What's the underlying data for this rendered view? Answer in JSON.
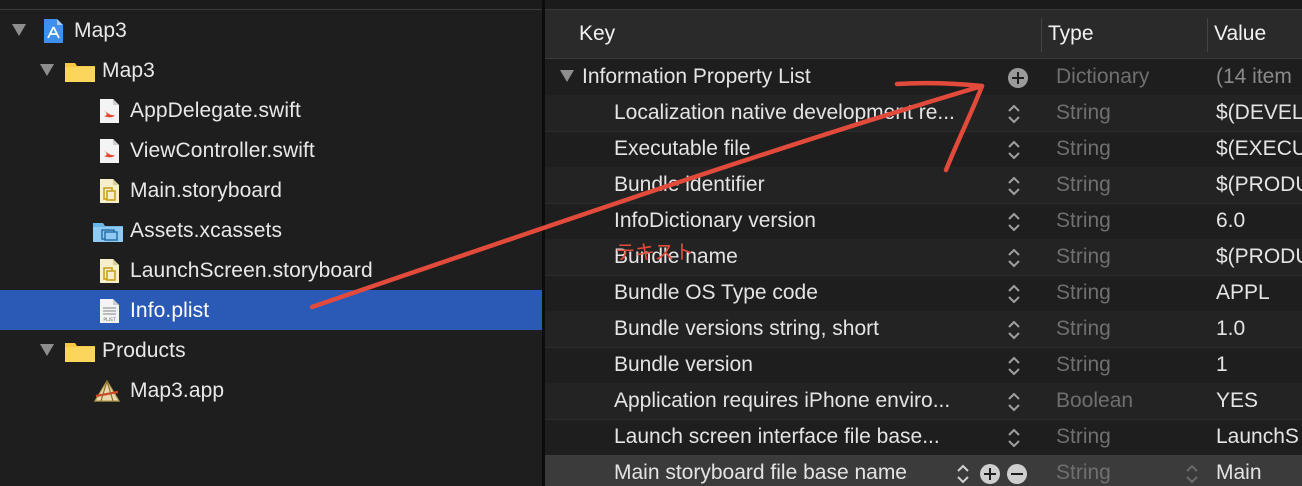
{
  "navigator": {
    "items": [
      {
        "label": "Map3",
        "icon": "xcode-project-icon",
        "expanded": true
      },
      {
        "label": "Map3",
        "icon": "folder-icon",
        "expanded": true
      },
      {
        "label": "AppDelegate.swift",
        "icon": "swift-file-icon"
      },
      {
        "label": "ViewController.swift",
        "icon": "swift-file-icon"
      },
      {
        "label": "Main.storyboard",
        "icon": "storyboard-file-icon"
      },
      {
        "label": "Assets.xcassets",
        "icon": "asset-catalog-icon"
      },
      {
        "label": "LaunchScreen.storyboard",
        "icon": "storyboard-file-icon"
      },
      {
        "label": "Info.plist",
        "icon": "plist-file-icon",
        "selected": true,
        "icon_text": "PLIST"
      },
      {
        "label": "Products",
        "icon": "folder-icon",
        "expanded": true
      },
      {
        "label": "Map3.app",
        "icon": "app-product-icon"
      }
    ]
  },
  "plist": {
    "headers": {
      "key": "Key",
      "type": "Type",
      "value": "Value"
    },
    "root": {
      "key": "Information Property List",
      "type": "Dictionary",
      "value": "(14 item"
    },
    "rows": [
      {
        "key": "Localization native development re...",
        "type": "String",
        "value": "$(DEVEL"
      },
      {
        "key": "Executable file",
        "type": "String",
        "value": "$(EXECU"
      },
      {
        "key": "Bundle identifier",
        "type": "String",
        "value": "$(PRODU"
      },
      {
        "key": "InfoDictionary version",
        "type": "String",
        "value": "6.0"
      },
      {
        "key": "Bundle name",
        "type": "String",
        "value": "$(PRODU"
      },
      {
        "key": "Bundle OS Type code",
        "type": "String",
        "value": "APPL"
      },
      {
        "key": "Bundle versions string, short",
        "type": "String",
        "value": "1.0"
      },
      {
        "key": "Bundle version",
        "type": "String",
        "value": "1"
      },
      {
        "key": "Application requires iPhone enviro...",
        "type": "Boolean",
        "value": "YES"
      },
      {
        "key": "Launch screen interface file base...",
        "type": "String",
        "value": "LaunchS"
      },
      {
        "key": "Main storyboard file base name",
        "type": "String",
        "value": "Main",
        "selected": true
      }
    ]
  },
  "annotation": {
    "text": "テキスト",
    "color": "#e24a3b"
  },
  "colors": {
    "selection": "#2b5ab6",
    "background": "#1e1e1e",
    "arrow": "#e24a3b"
  }
}
